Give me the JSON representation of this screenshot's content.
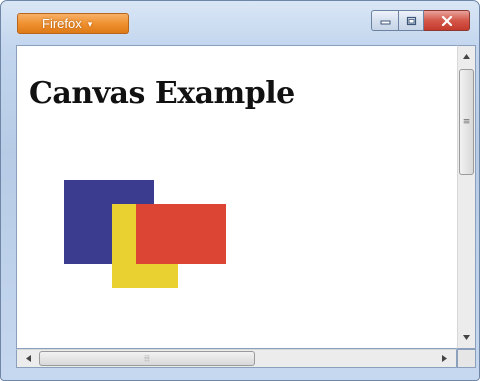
{
  "window": {
    "app_button_label": "Firefox",
    "app_button_caret": "▾",
    "controls": [
      "minimize-icon",
      "maximize-icon",
      "close-icon"
    ]
  },
  "page": {
    "title": "Canvas Example"
  },
  "canvas": {
    "shapes": [
      {
        "name": "blue-rectangle",
        "color": "#3b3b8f"
      },
      {
        "name": "yellow-rectangle",
        "color": "#e8d131"
      },
      {
        "name": "red-rectangle",
        "color": "#dc4534"
      }
    ]
  },
  "scrollbars": {
    "vertical_grip": "≡",
    "horizontal_grip": "⦙⦙⦙"
  }
}
